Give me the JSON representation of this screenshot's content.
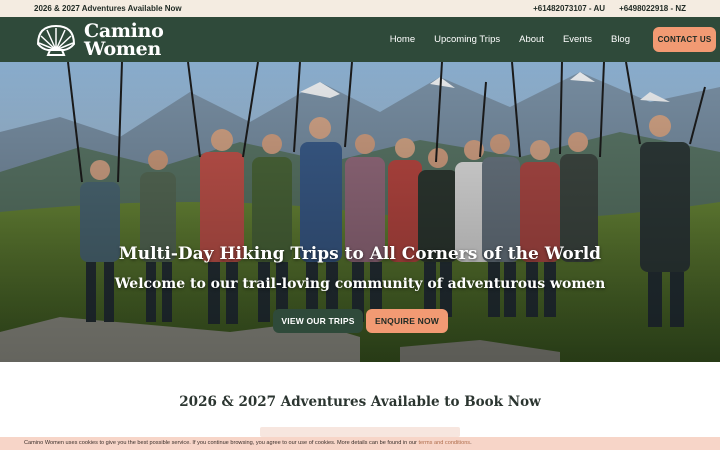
{
  "topbar": {
    "announcement": "2026 & 2027 Adventures Available Now",
    "phone_au": "+61482073107 - AU",
    "phone_nz": "+6498022918 - NZ"
  },
  "header": {
    "logo_line1": "Camino",
    "logo_line2": "Women",
    "logo_icon": "scallop-shell-icon",
    "nav": [
      "Home",
      "Upcoming Trips",
      "About",
      "Events",
      "Blog"
    ],
    "contact_label": "CONTACT US"
  },
  "hero": {
    "title": "Multi-Day Hiking Trips to All Corners of the World",
    "subtitle": "Welcome to our trail-loving community of adventurous women",
    "btn_trips": "VIEW OUR TRIPS",
    "btn_enquire": "ENQUIRE NOW"
  },
  "section": {
    "title": "2026 & 2027 Adventures Available to Book Now"
  },
  "cookie": {
    "text": "Camino Women uses cookies to give you the best possible service. If you continue browsing, you agree to our use of cookies. More details can be found in our ",
    "link": "terms and conditions",
    "end": "."
  },
  "colors": {
    "brand_green": "#2f4a3a",
    "accent_peach": "#f29a73",
    "topbar_bg": "#f4ece1",
    "cookie_bg": "#f7d5c8"
  }
}
